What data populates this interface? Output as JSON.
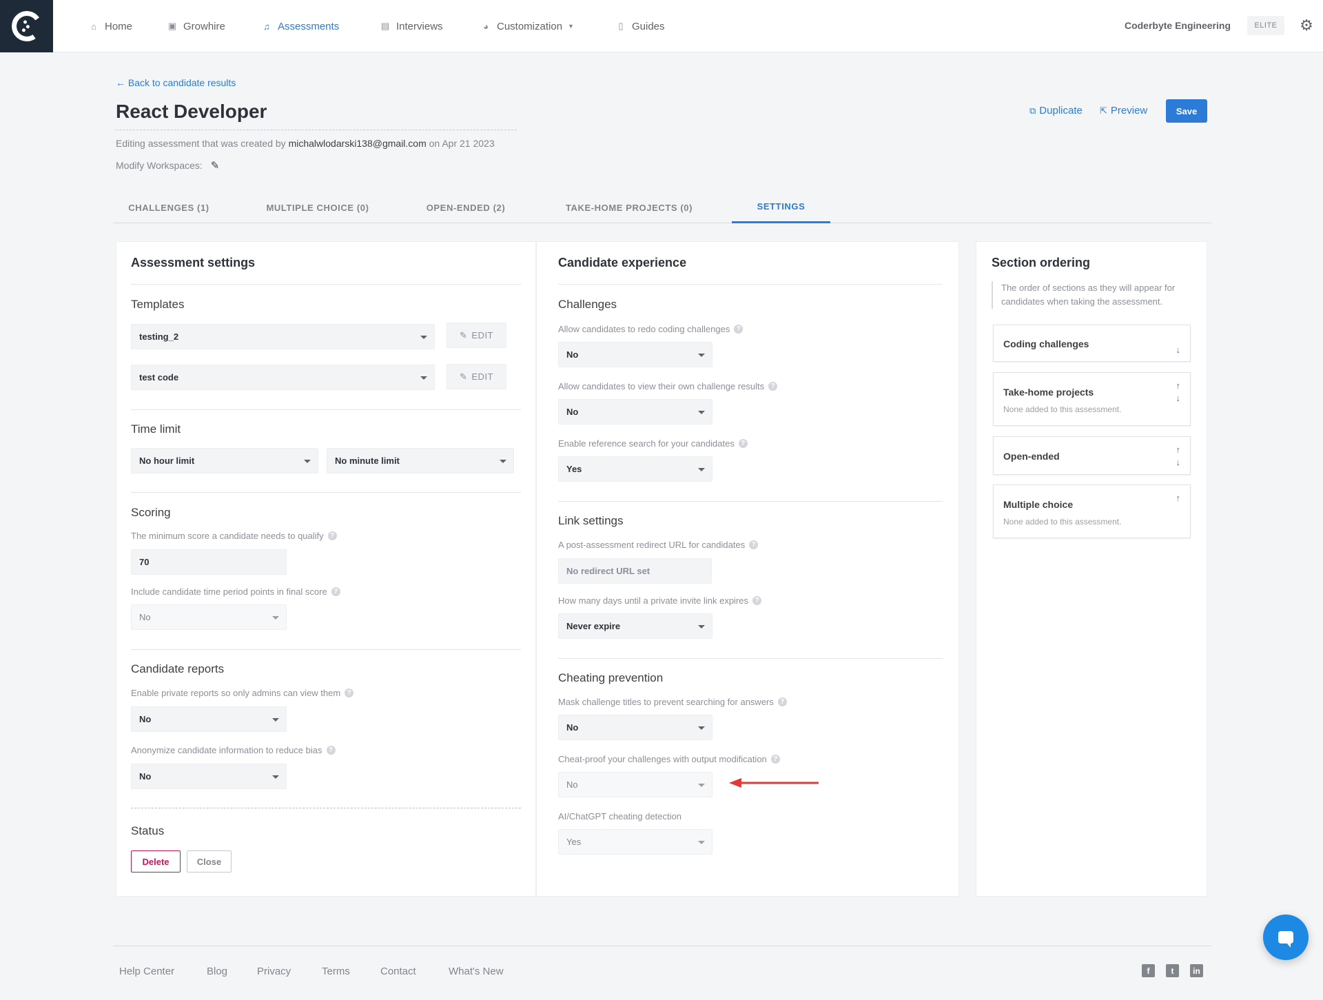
{
  "nav": {
    "items": [
      {
        "label": "Home",
        "icon": "home-icon"
      },
      {
        "label": "Growhire",
        "icon": "growhire-icon"
      },
      {
        "label": "Assessments",
        "icon": "assessments-icon"
      },
      {
        "label": "Interviews",
        "icon": "interviews-icon"
      },
      {
        "label": "Customization",
        "icon": "palette-icon"
      },
      {
        "label": "Guides",
        "icon": "book-icon"
      }
    ],
    "active": "Assessments",
    "org_name": "Coderbyte Engineering",
    "plan": "ELITE"
  },
  "header": {
    "back_link": "← Back to candidate results",
    "title": "React Developer",
    "meta_prefix": "Editing assessment that was created by ",
    "meta_email": "michalwlodarski138@gmail.com",
    "meta_suffix": " on Apr 21 2023",
    "workspaces_label": "Modify Workspaces:",
    "duplicate": "Duplicate",
    "preview": "Preview",
    "save": "Save"
  },
  "tabs": [
    {
      "label": "CHALLENGES (1)"
    },
    {
      "label": "MULTIPLE CHOICE (0)"
    },
    {
      "label": "OPEN-ENDED (2)"
    },
    {
      "label": "TAKE-HOME PROJECTS (0)"
    },
    {
      "label": "SETTINGS"
    }
  ],
  "active_tab": "SETTINGS",
  "assessment_settings": {
    "title": "Assessment settings",
    "templates": {
      "title": "Templates",
      "items": [
        {
          "value": "testing_2",
          "edit": "EDIT"
        },
        {
          "value": "test code",
          "edit": "EDIT"
        }
      ]
    },
    "time_limit": {
      "title": "Time limit",
      "hours": "No hour limit",
      "minutes": "No minute limit"
    },
    "scoring": {
      "title": "Scoring",
      "min_score_label": "The minimum score a candidate needs to qualify",
      "min_score_value": "70",
      "time_points_label": "Include candidate time period points in final score",
      "time_points_value": "No"
    },
    "reports": {
      "title": "Candidate reports",
      "private_label": "Enable private reports so only admins can view them",
      "private_value": "No",
      "anonymize_label": "Anonymize candidate information to reduce bias",
      "anonymize_value": "No"
    },
    "status": {
      "title": "Status",
      "delete": "Delete",
      "close": "Close"
    }
  },
  "candidate_experience": {
    "title": "Candidate experience",
    "challenges": {
      "title": "Challenges",
      "redo_label": "Allow candidates to redo coding challenges",
      "redo_value": "No",
      "view_results_label": "Allow candidates to view their own challenge results",
      "view_results_value": "No",
      "reference_label": "Enable reference search for your candidates",
      "reference_value": "Yes"
    },
    "link_settings": {
      "title": "Link settings",
      "redirect_label": "A post-assessment redirect URL for candidates",
      "redirect_placeholder": "No redirect URL set",
      "expire_label": "How many days until a private invite link expires",
      "expire_value": "Never expire"
    },
    "cheating": {
      "title": "Cheating prevention",
      "mask_label": "Mask challenge titles to prevent searching for answers",
      "mask_value": "No",
      "cheatproof_label": "Cheat-proof your challenges with output modification",
      "cheatproof_value": "No",
      "ai_label": "AI/ChatGPT cheating detection",
      "ai_value": "Yes"
    }
  },
  "section_ordering": {
    "title": "Section ordering",
    "description": "The order of sections as they will appear for candidates when taking the assessment.",
    "items": [
      {
        "name": "Coding challenges",
        "sub": ""
      },
      {
        "name": "Take-home projects",
        "sub": "None added to this assessment."
      },
      {
        "name": "Open-ended",
        "sub": ""
      },
      {
        "name": "Multiple choice",
        "sub": "None added to this assessment."
      }
    ]
  },
  "footer": {
    "links": [
      "Help Center",
      "Blog",
      "Privacy",
      "Terms",
      "Contact",
      "What's New"
    ],
    "social": [
      "facebook-icon",
      "twitter-icon",
      "linkedin-icon"
    ]
  },
  "colors": {
    "accent": "#2b7bd7",
    "danger": "#c2185b",
    "annotation_arrow": "#e53935"
  }
}
